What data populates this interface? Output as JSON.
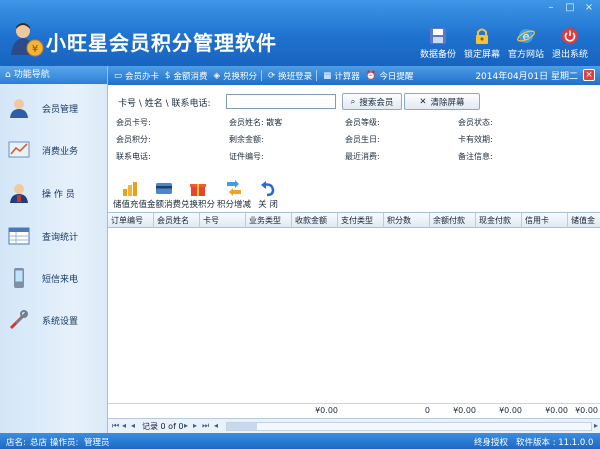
{
  "app": {
    "title": "小旺星会员积分管理软件",
    "window_controls": [
      "–",
      "□",
      "×"
    ]
  },
  "header_tools": [
    {
      "label": "数据备份",
      "icon": "save-disk-icon"
    },
    {
      "label": "锁定屏幕",
      "icon": "lock-icon"
    },
    {
      "label": "官方网站",
      "icon": "internet-explorer-icon"
    },
    {
      "label": "退出系统",
      "icon": "power-icon"
    }
  ],
  "sidebar": {
    "title": "功能导航",
    "items": [
      {
        "label": "会员管理",
        "icon": "member-user-icon"
      },
      {
        "label": "消费业务",
        "icon": "consumption-chart-icon"
      },
      {
        "label": "操 作 员",
        "icon": "operator-icon"
      },
      {
        "label": "查询统计",
        "icon": "query-table-icon"
      },
      {
        "label": "短信来电",
        "icon": "mobile-phone-icon"
      },
      {
        "label": "系统设置",
        "icon": "tools-icon"
      }
    ]
  },
  "quick_toolbar": {
    "items": [
      {
        "label": "会员办卡",
        "icon": "card-icon"
      },
      {
        "label": "金额消费",
        "icon": "money-icon"
      },
      {
        "label": "兑换积分",
        "icon": "gift-icon"
      },
      {
        "label": "换班登录",
        "icon": "switch-shift-icon"
      },
      {
        "label": "计算器",
        "icon": "calculator-icon"
      },
      {
        "label": "今日提醒",
        "icon": "alarm-clock-icon"
      }
    ],
    "date": "2014年04月01日  星期二"
  },
  "search": {
    "label": "卡号 \\ 姓名 \\ 联系电话:",
    "value": "",
    "search_button": "搜索会员",
    "clear_button": "清除屏幕"
  },
  "member_info": [
    [
      "会员卡号:",
      "会员姓名: 散客",
      "会员等级:",
      "会员状态:"
    ],
    [
      "会员积分:",
      "剩余金额:",
      "会员生日:",
      "卡有效期:"
    ],
    [
      "联系电话:",
      "证件编号:",
      "最近消费:",
      "备注信息:"
    ]
  ],
  "operations": [
    {
      "label": "储值充值",
      "icon": "coins-stack-icon"
    },
    {
      "label": "金额消费",
      "icon": "bank-card-icon"
    },
    {
      "label": "兑换积分",
      "icon": "gift-box-icon"
    },
    {
      "label": "积分增减",
      "icon": "arrows-icon"
    },
    {
      "label": "关  闭",
      "icon": "undo-icon"
    }
  ],
  "table": {
    "columns": [
      "订单编号",
      "会员姓名",
      "卡号",
      "业务类型",
      "收款金额",
      "支付类型",
      "积分数",
      "余额付款",
      "现金付款",
      "信用卡",
      "储值金"
    ],
    "rows": [],
    "totals": {
      "收款金额": "¥0.00",
      "积分数": "0",
      "余额付款": "¥0.00",
      "现金付款": "¥0.00",
      "信用卡": "¥0.00",
      "储值金": "¥0.00"
    }
  },
  "pager": {
    "text": "记录 0 of 0"
  },
  "status": {
    "store_label": "店名:",
    "store_value": "总店",
    "operator_label": "操作员:",
    "operator_value": "管理员",
    "license": "终身授权",
    "version": "软件版本 : 11.1.0.0"
  }
}
